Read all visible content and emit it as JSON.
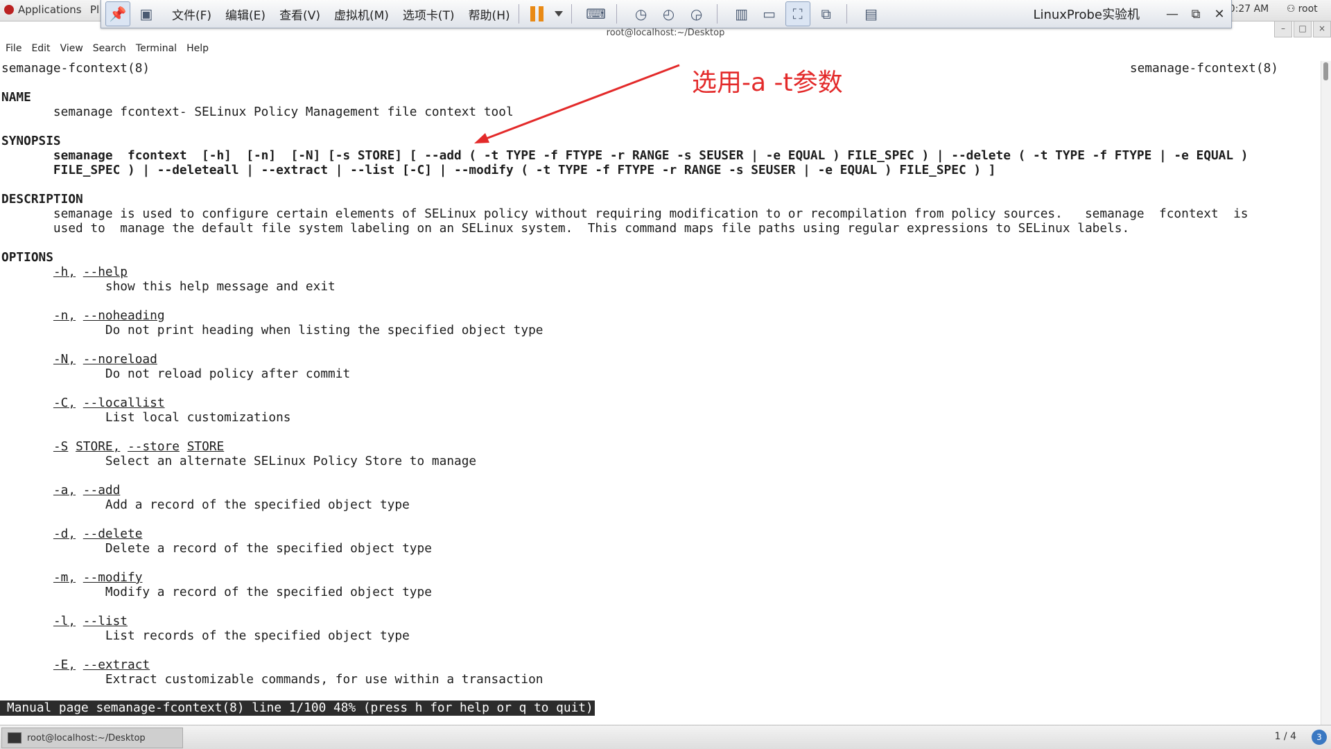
{
  "topbar": {
    "applications": "Applications",
    "places": "Pl",
    "clock": ":0:27 AM",
    "user": "root"
  },
  "vmware": {
    "menus": [
      "文件(F)",
      "编辑(E)",
      "查看(V)",
      "虚拟机(M)",
      "选项卡(T)",
      "帮助(H)"
    ],
    "title": "LinuxProbe实验机"
  },
  "window": {
    "title": "root@localhost:~/Desktop"
  },
  "term_menu": [
    "File",
    "Edit",
    "View",
    "Search",
    "Terminal",
    "Help"
  ],
  "man": {
    "header_left": "semanage-fcontext(8)",
    "header_right": "semanage-fcontext(8)",
    "name_heading": "NAME",
    "name_text": "       semanage fcontext- SELinux Policy Management file context tool",
    "synopsis_heading": "SYNOPSIS",
    "synopsis_1": "       semanage  fcontext  [-h]  [-n]  [-N] [-s STORE] [ --add ( -t TYPE -f FTYPE -r RANGE -s SEUSER | -e EQUAL ) FILE_SPEC ) | --delete ( -t TYPE -f FTYPE | -e EQUAL )",
    "synopsis_2": "       FILE_SPEC ) | --deleteall | --extract | --list [-C] | --modify ( -t TYPE -f FTYPE -r RANGE -s SEUSER | -e EQUAL ) FILE_SPEC ) ]",
    "description_heading": "DESCRIPTION",
    "description_1": "       semanage is used to configure certain elements of SELinux policy without requiring modification to or recompilation from policy sources.   semanage  fcontext  is",
    "description_2": "       used to  manage the default file system labeling on an SELinux system.  This command maps file paths using regular expressions to SELinux labels.",
    "options_heading": "OPTIONS",
    "options": [
      {
        "flag": "-h,",
        "long": "--help",
        "desc": "show this help message and exit"
      },
      {
        "flag": "-n,",
        "long": "--noheading",
        "desc": "Do not print heading when listing the specified object type"
      },
      {
        "flag": "-N,",
        "long": "--noreload",
        "desc": "Do not reload policy after commit"
      },
      {
        "flag": "-C,",
        "long": "--locallist",
        "desc": "List local customizations"
      },
      {
        "flag": "-S",
        "arg": "STORE,",
        "long": "--store",
        "arg2": "STORE",
        "desc": "Select an alternate SELinux Policy Store to manage"
      },
      {
        "flag": "-a,",
        "long": "--add",
        "desc": "Add a record of the specified object type"
      },
      {
        "flag": "-d,",
        "long": "--delete",
        "desc": "Delete a record of the specified object type"
      },
      {
        "flag": "-m,",
        "long": "--modify",
        "desc": "Modify a record of the specified object type"
      },
      {
        "flag": "-l,",
        "long": "--list",
        "desc": "List records of the specified object type"
      },
      {
        "flag": "-E,",
        "long": "--extract",
        "desc": "Extract customizable commands, for use within a transaction"
      }
    ],
    "status": "Manual page semanage-fcontext(8) line 1/100 48% (press h for help or q to quit)"
  },
  "annotation": "选用-a -t参数",
  "taskbar": {
    "item": "root@localhost:~/Desktop",
    "pager": "1 / 4"
  },
  "colors": {
    "annotation": "#e32a2a",
    "status_bg": "#2c2c2c"
  }
}
